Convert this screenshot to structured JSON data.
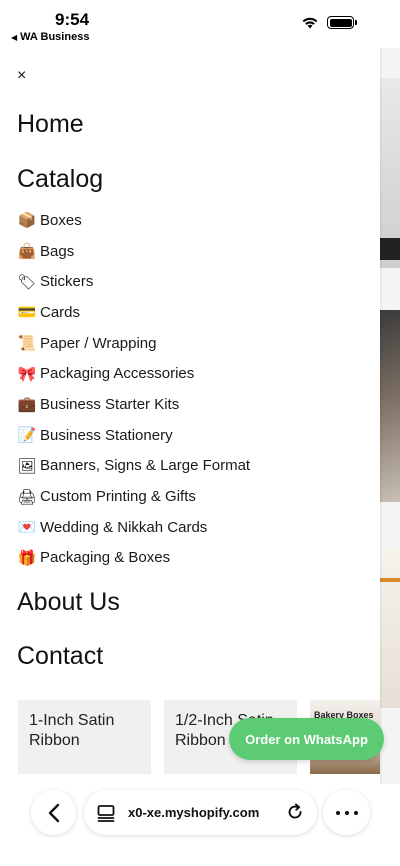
{
  "status": {
    "time": "9:54",
    "back_app": "WA Business"
  },
  "menu": {
    "close_label": "×",
    "home": "Home",
    "catalog": "Catalog",
    "about": "About Us",
    "contact": "Contact",
    "categories": [
      {
        "emoji": "📦",
        "label": "Boxes"
      },
      {
        "emoji": "👜",
        "label": "Bags"
      },
      {
        "emoji": "🏷",
        "label": "Stickers"
      },
      {
        "emoji": "💳",
        "label": "Cards"
      },
      {
        "emoji": "📜",
        "label": "Paper / Wrapping"
      },
      {
        "emoji": "🎀",
        "label": "Packaging Accessories"
      },
      {
        "emoji": "💼",
        "label": "Business Starter Kits"
      },
      {
        "emoji": "📝",
        "label": "Business Stationery"
      },
      {
        "emoji": "🖼",
        "label": "Banners, Signs & Large Format"
      },
      {
        "emoji": "🖨",
        "label": "Custom Printing & Gifts"
      },
      {
        "emoji": "💌",
        "label": "Wedding & Nikkah Cards"
      },
      {
        "emoji": "🎁",
        "label": "Packaging & Boxes"
      }
    ]
  },
  "cards": [
    {
      "title": "1-Inch Satin Ribbon"
    },
    {
      "title": "1/2-Inch Satin Ribbon"
    },
    {
      "title": "Bakery Boxes"
    }
  ],
  "whatsapp_button": "Order on WhatsApp",
  "browser": {
    "url": "x0-xe.myshopify.com"
  }
}
